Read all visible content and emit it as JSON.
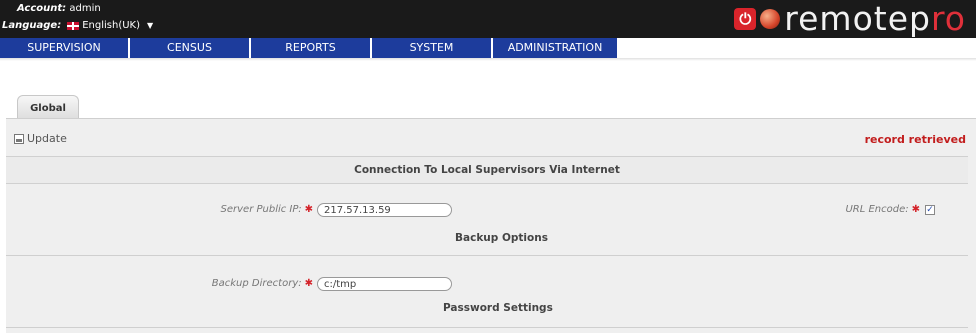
{
  "header": {
    "account_label": "Account:",
    "account_value": "admin",
    "language_label": "Language:",
    "language_value": "English(UK)",
    "language_flag_icon": "uk-flag-icon",
    "logo": {
      "icon": "power-icon",
      "ball_icon": "fireball-icon",
      "text_main": "remotep",
      "text_accent": "ro",
      "accent_color": "#e0303a"
    }
  },
  "nav": {
    "items": [
      {
        "label": "SUPERVISION"
      },
      {
        "label": "CENSUS"
      },
      {
        "label": "REPORTS"
      },
      {
        "label": "SYSTEM"
      },
      {
        "label": "ADMINISTRATION"
      }
    ],
    "color": "#1d3c9c"
  },
  "tabs": [
    {
      "label": "Global"
    }
  ],
  "toolbar": {
    "update_label": "Update",
    "update_icon": "save-icon",
    "status_text": "record retrieved",
    "status_color": "#c21d1d"
  },
  "sections": {
    "connection": {
      "title": "Connection To Local Supervisors Via Internet",
      "server_ip_label": "Server Public IP:",
      "server_ip_value": "217.57.13.59",
      "url_encode_label": "URL Encode:",
      "url_encode_checked": true
    },
    "backup": {
      "title": "Backup Options",
      "directory_label": "Backup Directory:",
      "directory_value": "c:/tmp"
    },
    "password": {
      "title": "Password Settings"
    }
  }
}
